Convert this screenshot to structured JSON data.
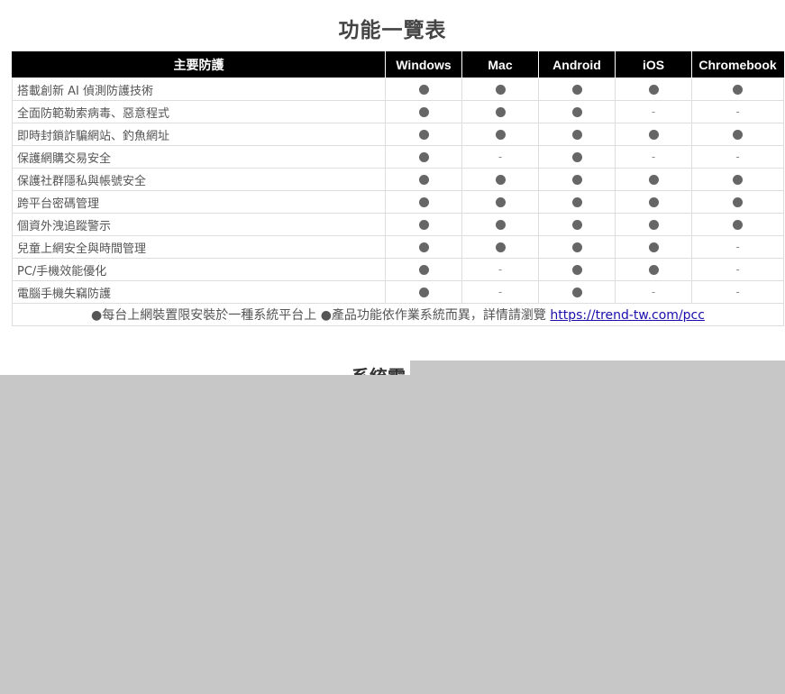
{
  "title": "功能一覽表",
  "table": {
    "headers": [
      "主要防護",
      "Windows",
      "Mac",
      "Android",
      "iOS",
      "Chromebook"
    ],
    "rows": [
      {
        "feature": "搭載創新 AI 偵測防護技術",
        "values": [
          "●",
          "●",
          "●",
          "●",
          "●"
        ]
      },
      {
        "feature": "全面防範勒索病毒、惡意程式",
        "values": [
          "●",
          "●",
          "●",
          "-",
          "-"
        ]
      },
      {
        "feature": "即時封鎖詐騙網站、釣魚網址",
        "values": [
          "●",
          "●",
          "●",
          "●",
          "●"
        ]
      },
      {
        "feature": "保護網購交易安全",
        "values": [
          "●",
          "-",
          "●",
          "-",
          "-"
        ]
      },
      {
        "feature": "保護社群隱私與帳號安全",
        "values": [
          "●",
          "●",
          "●",
          "●",
          "●"
        ]
      },
      {
        "feature": "跨平台密碼管理",
        "values": [
          "●",
          "●",
          "●",
          "●",
          "●"
        ]
      },
      {
        "feature": "個資外洩追蹤警示",
        "values": [
          "●",
          "●",
          "●",
          "●",
          "●"
        ]
      },
      {
        "feature": "兒童上網安全與時間管理",
        "values": [
          "●",
          "●",
          "●",
          "●",
          "-"
        ]
      },
      {
        "feature": "PC/手機效能優化",
        "values": [
          "●",
          "-",
          "●",
          "●",
          "-"
        ]
      },
      {
        "feature": "電腦手機失竊防護",
        "values": [
          "●",
          "-",
          "●",
          "-",
          "-"
        ]
      }
    ],
    "footer_note": "●每台上網裝置限安裝於一種系統平台上 ●產品功能依作業系統而異，詳情請瀏覽 ",
    "footer_link": "https://trend-tw.com/pcc"
  },
  "section_heading": "系統需"
}
